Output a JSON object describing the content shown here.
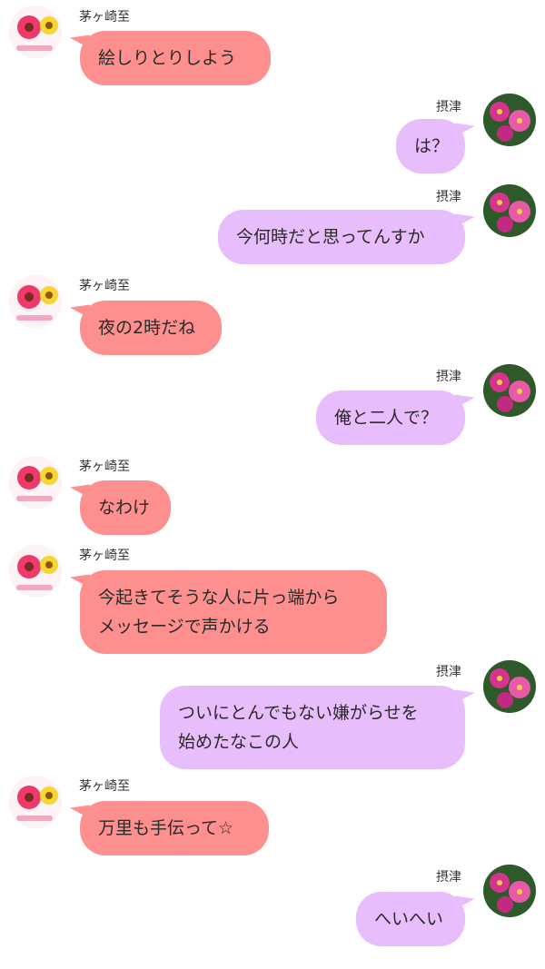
{
  "contacts": {
    "left_name": "茅ヶ崎至",
    "right_name": "摂津"
  },
  "colors": {
    "left_bubble": "#fd8f8f",
    "right_bubble": "#e8bdfc",
    "background": "#ffffff"
  },
  "messages": [
    {
      "side": "left",
      "text": [
        "絵しりとりしよう"
      ]
    },
    {
      "side": "right",
      "text": [
        "は？"
      ]
    },
    {
      "side": "right",
      "text": [
        "今何時だと思ってんすか"
      ]
    },
    {
      "side": "left",
      "text": [
        "夜の2時だね"
      ]
    },
    {
      "side": "right",
      "text": [
        "俺と二人で？"
      ]
    },
    {
      "side": "left",
      "text": [
        "なわけ"
      ]
    },
    {
      "side": "left",
      "text": [
        "今起きてそうな人に片っ端から",
        "メッセージで声かける"
      ]
    },
    {
      "side": "right",
      "text": [
        "ついにとんでもない嫌がらせを",
        "始めたなこの人"
      ]
    },
    {
      "side": "left",
      "text": [
        "万里も手伝って☆"
      ]
    },
    {
      "side": "right",
      "text": [
        "へいへい"
      ]
    }
  ]
}
